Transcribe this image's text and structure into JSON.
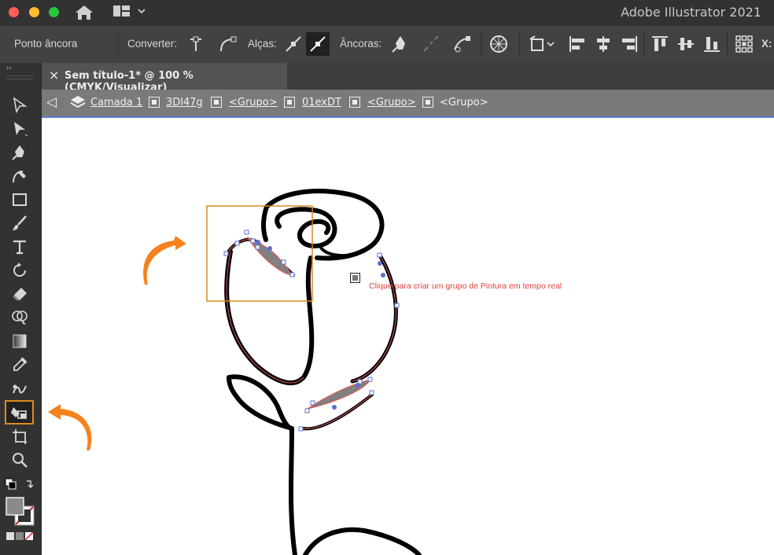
{
  "window": {
    "app_title": "Adobe Illustrator 2021",
    "traffic_lights": {
      "close": "#fe5f57",
      "minimize": "#febc2e",
      "zoom": "#28c840"
    }
  },
  "control_bar": {
    "selection_label": "Ponto âncora",
    "convert_label": "Converter:",
    "handles_label": "Alças:",
    "anchors_label": "Âncoras:",
    "x_label": "X:"
  },
  "document_tab": {
    "title": "Sem título-1* @ 100 % (CMYK/Visualizar)",
    "close_glyph": "×"
  },
  "breadcrumb": {
    "back_glyph": "◁",
    "items": [
      "Camada 1",
      "3Dl47g",
      "<Grupo>",
      "01exDT",
      "<Grupo>",
      "<Grupo>"
    ]
  },
  "canvas": {
    "hint_text": "Clique para criar um grupo de Pintura em tempo real",
    "arrow_color": "#f5821f",
    "selection_color": "#d88a20",
    "path_highlight": "#e05a5a"
  }
}
